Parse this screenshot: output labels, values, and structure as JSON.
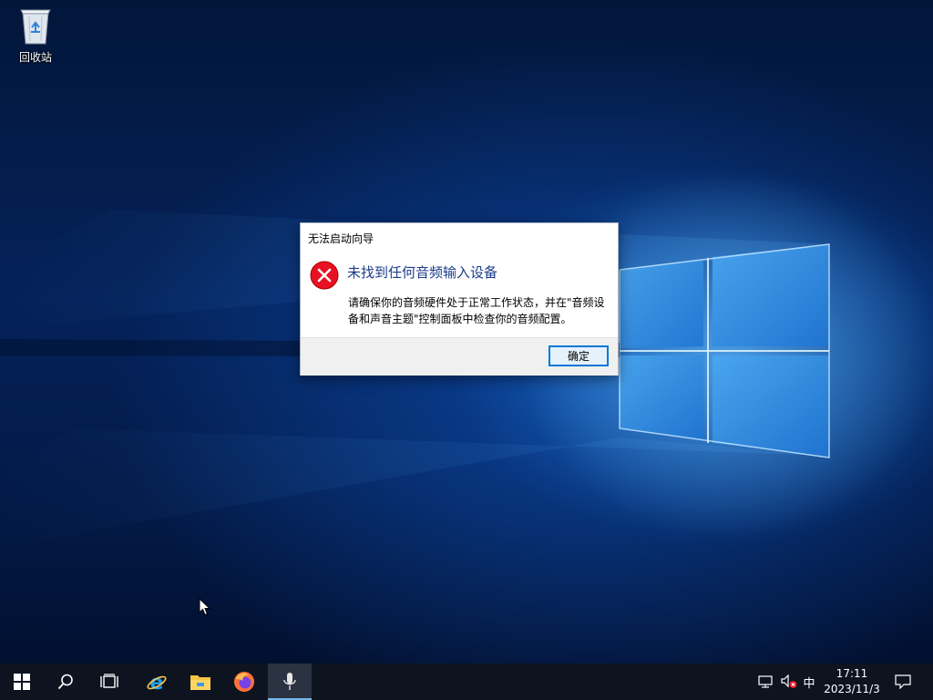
{
  "desktop": {
    "icons": [
      {
        "label": "回收站",
        "icon": "recycle-bin-icon"
      }
    ]
  },
  "dialog": {
    "title": "无法启动向导",
    "heading": "未找到任何音频输入设备",
    "message": "请确保你的音频硬件处于正常工作状态，并在\"音频设备和声音主题\"控制面板中检查你的音频配置。",
    "ok_label": "确定",
    "icon": "error-icon"
  },
  "taskbar": {
    "pinned": [
      {
        "name": "start-button",
        "icon": "windows-logo-icon"
      },
      {
        "name": "search-button",
        "icon": "search-icon"
      },
      {
        "name": "task-view-button",
        "icon": "task-view-icon"
      },
      {
        "name": "internet-explorer-button",
        "icon": "internet-explorer-icon"
      },
      {
        "name": "file-explorer-button",
        "icon": "folder-icon"
      },
      {
        "name": "firefox-button",
        "icon": "firefox-icon"
      },
      {
        "name": "voice-recorder-button",
        "icon": "microphone-icon",
        "active": true
      }
    ],
    "tray": {
      "network_icon": "network-icon",
      "volume_icon": "volume-muted-icon",
      "ime_label": "中",
      "time": "17:11",
      "date": "2023/11/3",
      "notification_icon": "notification-icon"
    }
  },
  "colors": {
    "accent": "#0078d7",
    "heading": "#1b3c8a",
    "error_red": "#e81123",
    "taskbar": "#0d1420"
  }
}
